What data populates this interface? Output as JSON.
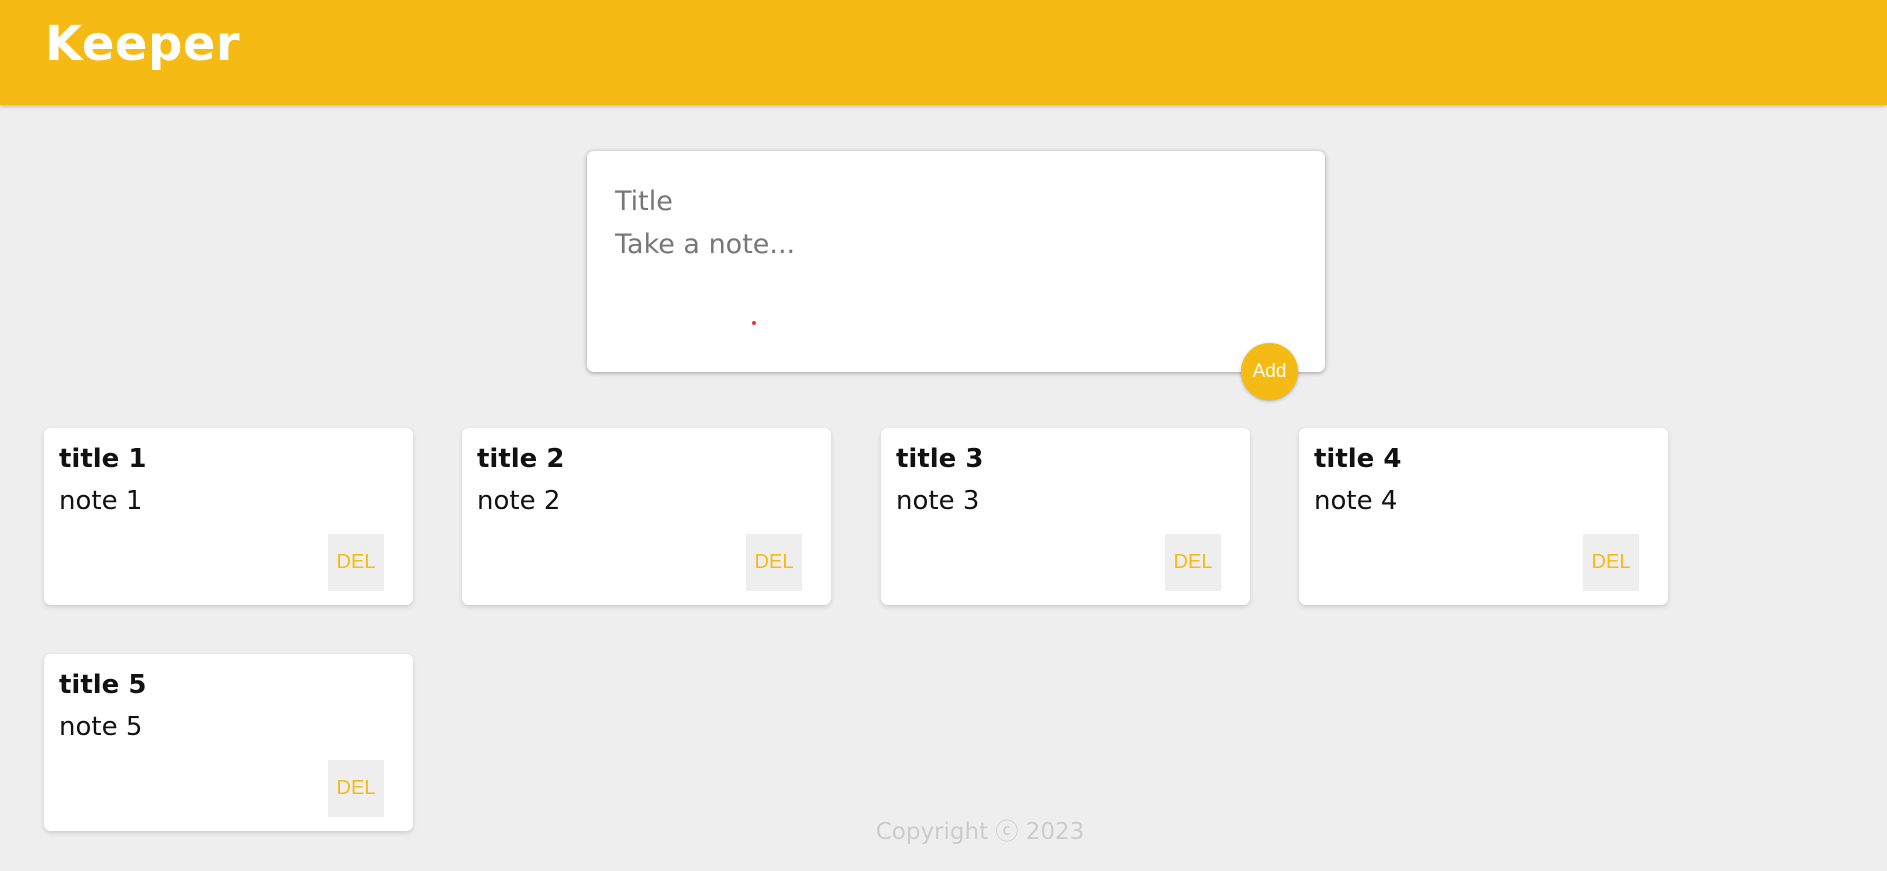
{
  "header": {
    "title": "Keeper"
  },
  "create_form": {
    "title_placeholder": "Title",
    "content_placeholder": "Take a note...",
    "add_label": "Add"
  },
  "notes": [
    {
      "title": "title 1",
      "content": "note 1",
      "delete_label": "DEL"
    },
    {
      "title": "title 2",
      "content": "note 2",
      "delete_label": "DEL"
    },
    {
      "title": "title 3",
      "content": "note 3",
      "delete_label": "DEL"
    },
    {
      "title": "title 4",
      "content": "note 4",
      "delete_label": "DEL"
    },
    {
      "title": "title 5",
      "content": "note 5",
      "delete_label": "DEL"
    }
  ],
  "footer": {
    "copyright": "Copyright ⓒ 2023"
  },
  "colors": {
    "brand": "#f5ba13",
    "background": "#eeeeee",
    "footer_text": "#cccccc"
  }
}
